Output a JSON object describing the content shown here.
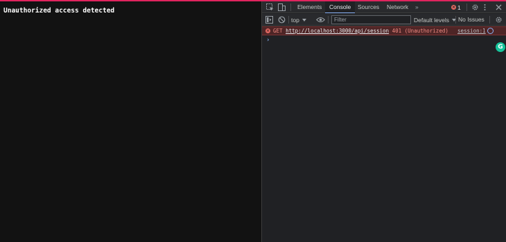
{
  "page": {
    "message": "Unauthorized access detected"
  },
  "devtools": {
    "tabs": [
      {
        "label": "Elements"
      },
      {
        "label": "Console",
        "active": true
      },
      {
        "label": "Sources"
      },
      {
        "label": "Network"
      }
    ],
    "more_tabs": "»",
    "error_badge": {
      "count": "1"
    },
    "toolbar": {
      "context": "top",
      "filter_placeholder": "Filter",
      "levels": "Default levels",
      "issues": "No Issues"
    },
    "console": {
      "entries": [
        {
          "level": "error",
          "method": "GET",
          "url": "http://localhost:3000/api/session",
          "status": "401 (Unauthorized)",
          "source": "session:1"
        }
      ],
      "prompt": "›"
    },
    "colors": {
      "accent": "#e0245e",
      "error": "#f28b82",
      "error_bg": "#4e2526",
      "link": "#8ab4f8",
      "grammarly": "#15c39a"
    }
  },
  "extension": {
    "grammarly_glyph": "G"
  }
}
